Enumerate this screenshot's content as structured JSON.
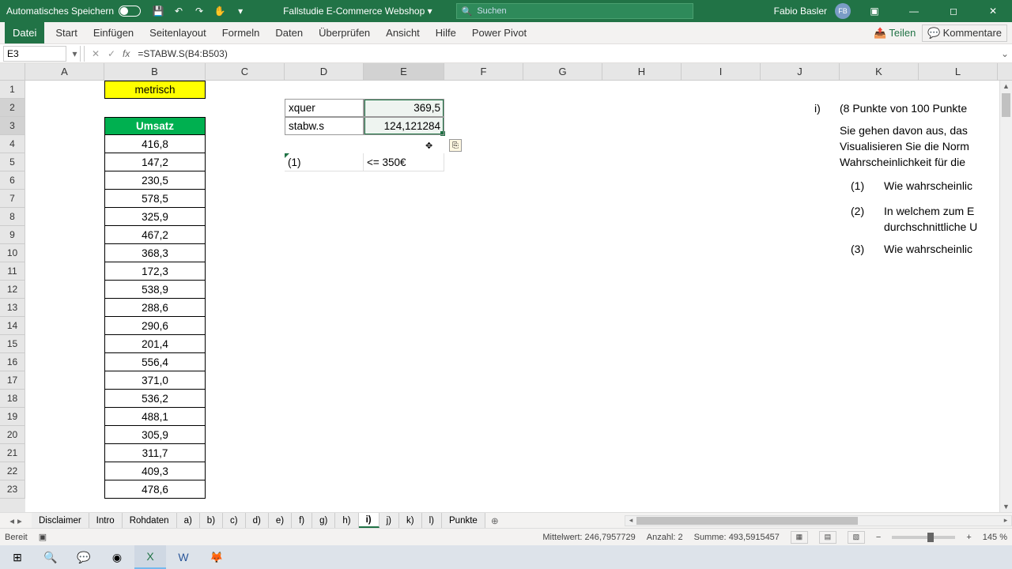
{
  "titlebar": {
    "autosave_label": "Automatisches Speichern",
    "doc_title": "Fallstudie E-Commerce Webshop",
    "search_placeholder": "Suchen",
    "user_name": "Fabio Basler",
    "user_initials": "FB"
  },
  "ribbon": {
    "file": "Datei",
    "tabs": [
      "Start",
      "Einfügen",
      "Seitenlayout",
      "Formeln",
      "Daten",
      "Überprüfen",
      "Ansicht",
      "Hilfe",
      "Power Pivot"
    ],
    "share": "Teilen",
    "comments": "Kommentare"
  },
  "formula_bar": {
    "name_box": "E3",
    "fx_label": "fx",
    "formula": "=STABW.S(B4:B503)"
  },
  "columns": [
    {
      "l": "A",
      "w": 100
    },
    {
      "l": "B",
      "w": 128
    },
    {
      "l": "C",
      "w": 100
    },
    {
      "l": "D",
      "w": 100
    },
    {
      "l": "E",
      "w": 102
    },
    {
      "l": "F",
      "w": 100
    },
    {
      "l": "G",
      "w": 100
    },
    {
      "l": "H",
      "w": 100
    },
    {
      "l": "I",
      "w": 100
    },
    {
      "l": "J",
      "w": 100
    },
    {
      "l": "K",
      "w": 100
    },
    {
      "l": "L",
      "w": 100
    }
  ],
  "row_count": 23,
  "cells": {
    "B1": {
      "v": "metrisch",
      "cls": "center yellow border-all"
    },
    "B3": {
      "v": "Umsatz",
      "cls": "center green bold border-all"
    },
    "D2": {
      "v": "xquer",
      "cls": "border-thin"
    },
    "E2": {
      "v": "369,5",
      "cls": "right border-thin"
    },
    "D3": {
      "v": "stabw.s",
      "cls": "border-thin"
    },
    "E3": {
      "v": "124,121284",
      "cls": "right border-thin"
    },
    "D5": {
      "v": "(1)",
      "cls": ""
    },
    "E5": {
      "v": "<= 350€",
      "cls": ""
    }
  },
  "col_b_data": [
    "416,8",
    "147,2",
    "230,5",
    "578,5",
    "325,9",
    "467,2",
    "368,3",
    "172,3",
    "538,9",
    "288,6",
    "290,6",
    "201,4",
    "556,4",
    "371,0",
    "536,2",
    "488,1",
    "305,9",
    "311,7",
    "409,3",
    "478,6"
  ],
  "right_text": {
    "heading_marker": "i)",
    "heading": "(8 Punkte von 100 Punkte",
    "p1a": "Sie gehen davon aus, das",
    "p1b": "Visualisieren Sie die Norm",
    "p1c": "Wahrscheinlichkeit für die",
    "q1_num": "(1)",
    "q1": "Wie wahrscheinlic",
    "q2_num": "(2)",
    "q2a": "In welchem zum E",
    "q2b": "durchschnittliche U",
    "q3_num": "(3)",
    "q3": "Wie wahrscheinlic"
  },
  "sheet_tabs": [
    "Disclaimer",
    "Intro",
    "Rohdaten",
    "a)",
    "b)",
    "c)",
    "d)",
    "e)",
    "f)",
    "g)",
    "h)",
    "i)",
    "j)",
    "k)",
    "l)",
    "Punkte"
  ],
  "active_sheet": "i)",
  "status": {
    "ready": "Bereit",
    "avg_label": "Mittelwert:",
    "avg": "246,7957729",
    "count_label": "Anzahl:",
    "count": "2",
    "sum_label": "Summe:",
    "sum": "493,5915457",
    "zoom": "145 %"
  }
}
